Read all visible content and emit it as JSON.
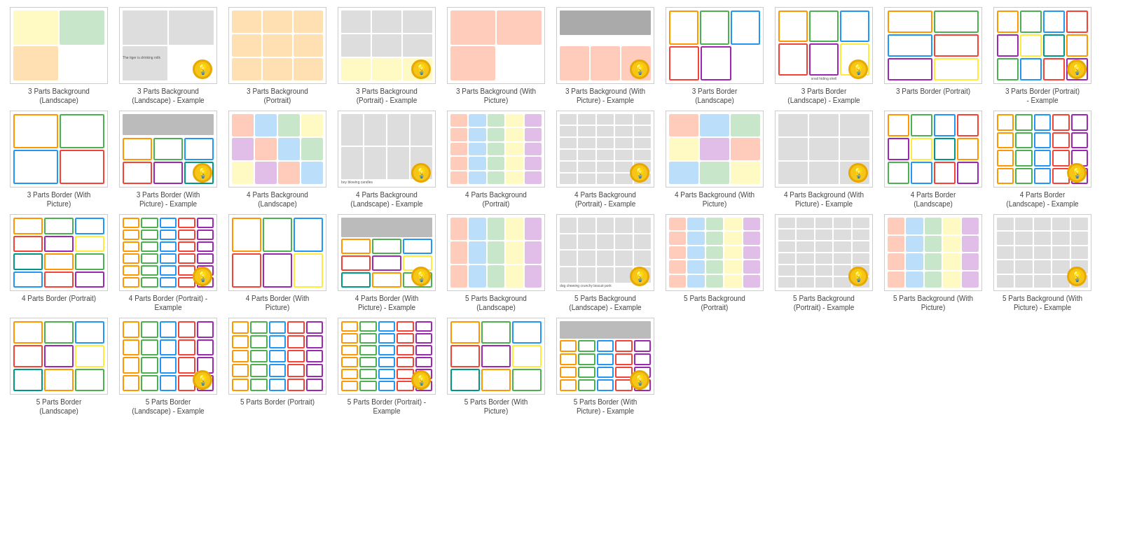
{
  "cards": [
    {
      "id": 1,
      "label": "3 Parts Background\n(Landscape)",
      "hasExample": false,
      "theme": "bg-landscape-3",
      "hasBulb": false
    },
    {
      "id": 2,
      "label": "3 Parts Background\n(Landscape) - Example",
      "hasExample": true,
      "theme": "bg-landscape-3-ex",
      "hasBulb": true
    },
    {
      "id": 3,
      "label": "3 Parts Background\n(Portrait)",
      "hasExample": false,
      "theme": "bg-portrait-3",
      "hasBulb": false
    },
    {
      "id": 4,
      "label": "3 Parts Background\n(Portrait) - Example",
      "hasExample": true,
      "theme": "bg-portrait-3-ex",
      "hasBulb": true
    },
    {
      "id": 5,
      "label": "3 Parts Background (With\nPicture)",
      "hasExample": false,
      "theme": "bg-with-pic-3",
      "hasBulb": false
    },
    {
      "id": 6,
      "label": "3 Parts Background (With\nPicture) - Example",
      "hasExample": true,
      "theme": "bg-with-pic-3-ex",
      "hasBulb": true
    },
    {
      "id": 7,
      "label": "3 Parts Border\n(Landscape)",
      "hasExample": false,
      "theme": "border-landscape-3",
      "hasBulb": false
    },
    {
      "id": 8,
      "label": "3 Parts Border\n(Landscape) - Example",
      "hasExample": true,
      "theme": "border-landscape-3-ex",
      "hasBulb": true
    },
    {
      "id": 9,
      "label": "3 Parts Border (Portrait)",
      "hasExample": false,
      "theme": "border-portrait-3",
      "hasBulb": false
    },
    {
      "id": 10,
      "label": "3 Parts Border (Portrait)\n- Example",
      "hasExample": true,
      "theme": "border-portrait-3-ex",
      "hasBulb": true
    },
    {
      "id": 11,
      "label": "3 Parts Border (With\nPicture)",
      "hasExample": false,
      "theme": "border-with-pic-3",
      "hasBulb": false
    },
    {
      "id": 12,
      "label": "3 Parts Border (With\nPicture) - Example",
      "hasExample": true,
      "theme": "border-with-pic-3-ex",
      "hasBulb": true
    },
    {
      "id": 13,
      "label": "4 Parts Background\n(Landscape)",
      "hasExample": false,
      "theme": "bg-landscape-4",
      "hasBulb": false
    },
    {
      "id": 14,
      "label": "4 Parts Background\n(Landscape) - Example",
      "hasExample": true,
      "theme": "bg-landscape-4-ex",
      "hasBulb": true
    },
    {
      "id": 15,
      "label": "4 Parts Background\n(Portrait)",
      "hasExample": false,
      "theme": "bg-portrait-4",
      "hasBulb": false
    },
    {
      "id": 16,
      "label": "4 Parts Background\n(Portrait) - Example",
      "hasExample": true,
      "theme": "bg-portrait-4-ex",
      "hasBulb": true
    },
    {
      "id": 17,
      "label": "4 Parts Background (With\nPicture)",
      "hasExample": false,
      "theme": "bg-with-pic-4",
      "hasBulb": false
    },
    {
      "id": 18,
      "label": "4 Parts Background (With\nPicture) - Example",
      "hasExample": true,
      "theme": "bg-with-pic-4-ex",
      "hasBulb": true
    },
    {
      "id": 19,
      "label": "4 Parts Border\n(Landscape)",
      "hasExample": false,
      "theme": "border-landscape-4",
      "hasBulb": false
    },
    {
      "id": 20,
      "label": "4 Parts Border\n(Landscape) - Example",
      "hasExample": true,
      "theme": "border-landscape-4-ex",
      "hasBulb": true
    },
    {
      "id": 21,
      "label": "4 Parts Border (Portrait)",
      "hasExample": false,
      "theme": "border-portrait-4",
      "hasBulb": false
    },
    {
      "id": 22,
      "label": "4 Parts Border (Portrait) -\nExample",
      "hasExample": true,
      "theme": "border-portrait-4-ex",
      "hasBulb": true
    },
    {
      "id": 23,
      "label": "4 Parts Border (With\nPicture)",
      "hasExample": false,
      "theme": "border-with-pic-4",
      "hasBulb": false
    },
    {
      "id": 24,
      "label": "4 Parts Border (With\nPicture) - Example",
      "hasExample": true,
      "theme": "border-with-pic-4-ex",
      "hasBulb": true
    },
    {
      "id": 25,
      "label": "5 Parts Background\n(Landscape)",
      "hasExample": false,
      "theme": "bg-landscape-5",
      "hasBulb": false
    },
    {
      "id": 26,
      "label": "5 Parts Background\n(Landscape) - Example",
      "hasExample": true,
      "theme": "bg-landscape-5-ex",
      "hasBulb": true
    },
    {
      "id": 27,
      "label": "5 Parts Background\n(Portrait)",
      "hasExample": false,
      "theme": "bg-portrait-5",
      "hasBulb": false
    },
    {
      "id": 28,
      "label": "5 Parts Background\n(Portrait) - Example",
      "hasExample": true,
      "theme": "bg-portrait-5-ex",
      "hasBulb": true
    },
    {
      "id": 29,
      "label": "5 Parts Background (With\nPicture)",
      "hasExample": false,
      "theme": "bg-with-pic-5",
      "hasBulb": false
    },
    {
      "id": 30,
      "label": "5 Parts Background (With\nPicture) - Example",
      "hasExample": true,
      "theme": "bg-with-pic-5-ex",
      "hasBulb": true
    },
    {
      "id": 31,
      "label": "5 Parts Border\n(Landscape)",
      "hasExample": false,
      "theme": "border-landscape-5",
      "hasBulb": false
    },
    {
      "id": 32,
      "label": "5 Parts Border\n(Landscape) - Example",
      "hasExample": true,
      "theme": "border-landscape-5-ex",
      "hasBulb": true
    },
    {
      "id": 33,
      "label": "5 Parts Border (Portrait)",
      "hasExample": false,
      "theme": "border-portrait-5",
      "hasBulb": false
    },
    {
      "id": 34,
      "label": "5 Parts Border (Portrait) -\nExample",
      "hasExample": true,
      "theme": "border-portrait-5-ex",
      "hasBulb": true
    },
    {
      "id": 35,
      "label": "5 Parts Border (With\nPicture)",
      "hasExample": false,
      "theme": "border-with-pic-5",
      "hasBulb": false
    },
    {
      "id": 36,
      "label": "5 Parts Border (With\nPicture) - Example",
      "hasExample": true,
      "theme": "border-with-pic-5-ex",
      "hasBulb": true
    }
  ]
}
